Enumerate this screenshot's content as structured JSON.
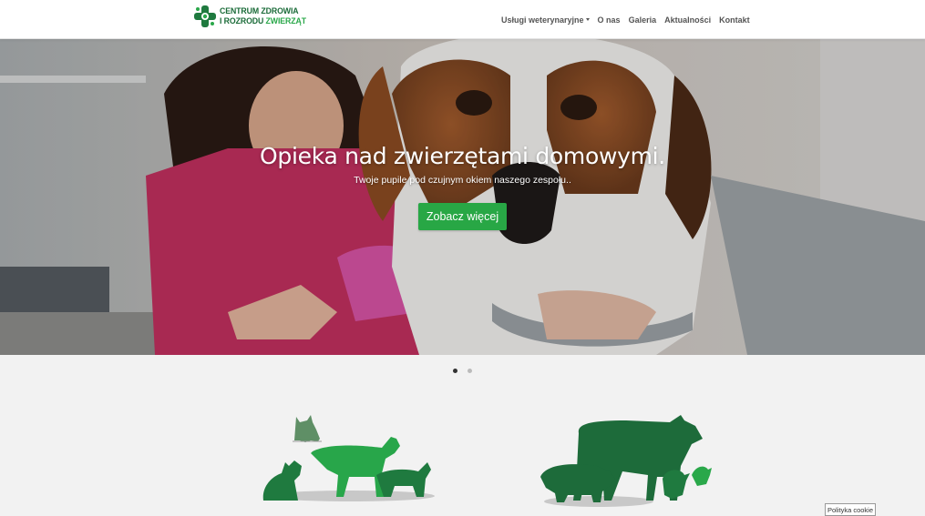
{
  "header": {
    "logo_line1": "CENTRUM ZDROWIA",
    "logo_line2a": "I ROZRODU ",
    "logo_line2b": "ZWIERZĄT",
    "nav": {
      "services": "Usługi weterynaryjne",
      "about": "O nas",
      "gallery": "Galeria",
      "news": "Aktualności",
      "contact": "Kontakt"
    }
  },
  "hero": {
    "title": "Opieka nad zwierzętami domowymi.",
    "subtitle": "Twoje pupile pod czujnym okiem naszego zespołu..",
    "button": "Zobacz więcej"
  },
  "carousel": {
    "slides": 2,
    "active": 1
  },
  "cookie_button": "Polityka cookie",
  "colors": {
    "brand_dark": "#1a6b38",
    "brand_light": "#2aa84a",
    "button": "#28a745"
  }
}
